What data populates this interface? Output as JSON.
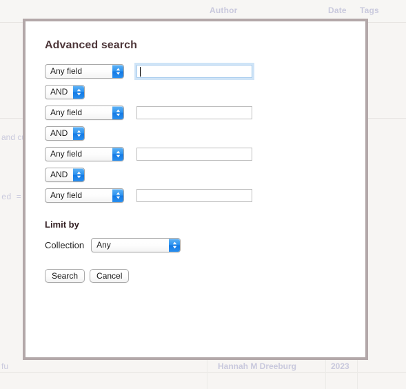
{
  "background": {
    "columns": [
      {
        "label": "Author"
      },
      {
        "label": "Date"
      },
      {
        "label": "Tags"
      }
    ],
    "fragments": [
      {
        "text": "and cu"
      },
      {
        "text": "ed = ["
      },
      {
        "text": "fu"
      },
      {
        "text": "Hannah M Dreeburg"
      },
      {
        "text": "2023"
      }
    ]
  },
  "modal": {
    "title": "Advanced search",
    "conditions": [
      {
        "field": {
          "value": "Any field"
        },
        "term": {
          "value": "",
          "placeholder": ""
        },
        "focused": true
      },
      {
        "field": {
          "value": "Any field"
        },
        "term": {
          "value": "",
          "placeholder": ""
        },
        "focused": false
      },
      {
        "field": {
          "value": "Any field"
        },
        "term": {
          "value": "",
          "placeholder": ""
        },
        "focused": false
      },
      {
        "field": {
          "value": "Any field"
        },
        "term": {
          "value": "",
          "placeholder": ""
        },
        "focused": false
      }
    ],
    "operators": [
      {
        "value": "AND"
      },
      {
        "value": "AND"
      },
      {
        "value": "AND"
      }
    ],
    "limit_by": {
      "title": "Limit by",
      "collection_label": "Collection",
      "collection": {
        "value": "Any"
      }
    },
    "actions": {
      "search_label": "Search",
      "cancel_label": "Cancel"
    }
  },
  "colors": {
    "modal_border": "#b3a8a9",
    "page_background": "#f7f5f3",
    "title_text": "#4d3639",
    "stepper_blue": "#2d93f0",
    "focus_ring": "#cfe4f7",
    "background_text": "#c9c9dd"
  }
}
